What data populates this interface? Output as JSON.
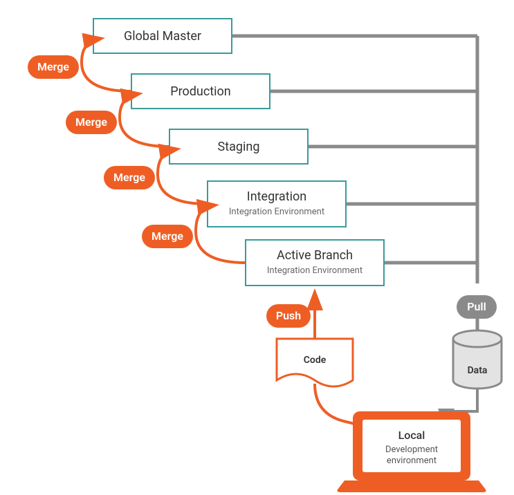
{
  "colors": {
    "orange": "#ee5e24",
    "teal": "#3a9a9a",
    "gray": "#8a8a8a",
    "lightgray": "#e3e3e3",
    "text": "#333333"
  },
  "stages": [
    {
      "title": "Global Master",
      "sub": ""
    },
    {
      "title": "Production",
      "sub": ""
    },
    {
      "title": "Staging",
      "sub": ""
    },
    {
      "title": "Integration",
      "sub": "Integration Environment"
    },
    {
      "title": "Active Branch",
      "sub": "Integration Environment"
    }
  ],
  "badges": {
    "merge": "Merge",
    "push": "Push",
    "pull": "Pull"
  },
  "code_label": "Code",
  "data_label": "Data",
  "local": {
    "title": "Local",
    "sub1": "Development",
    "sub2": "environment"
  }
}
